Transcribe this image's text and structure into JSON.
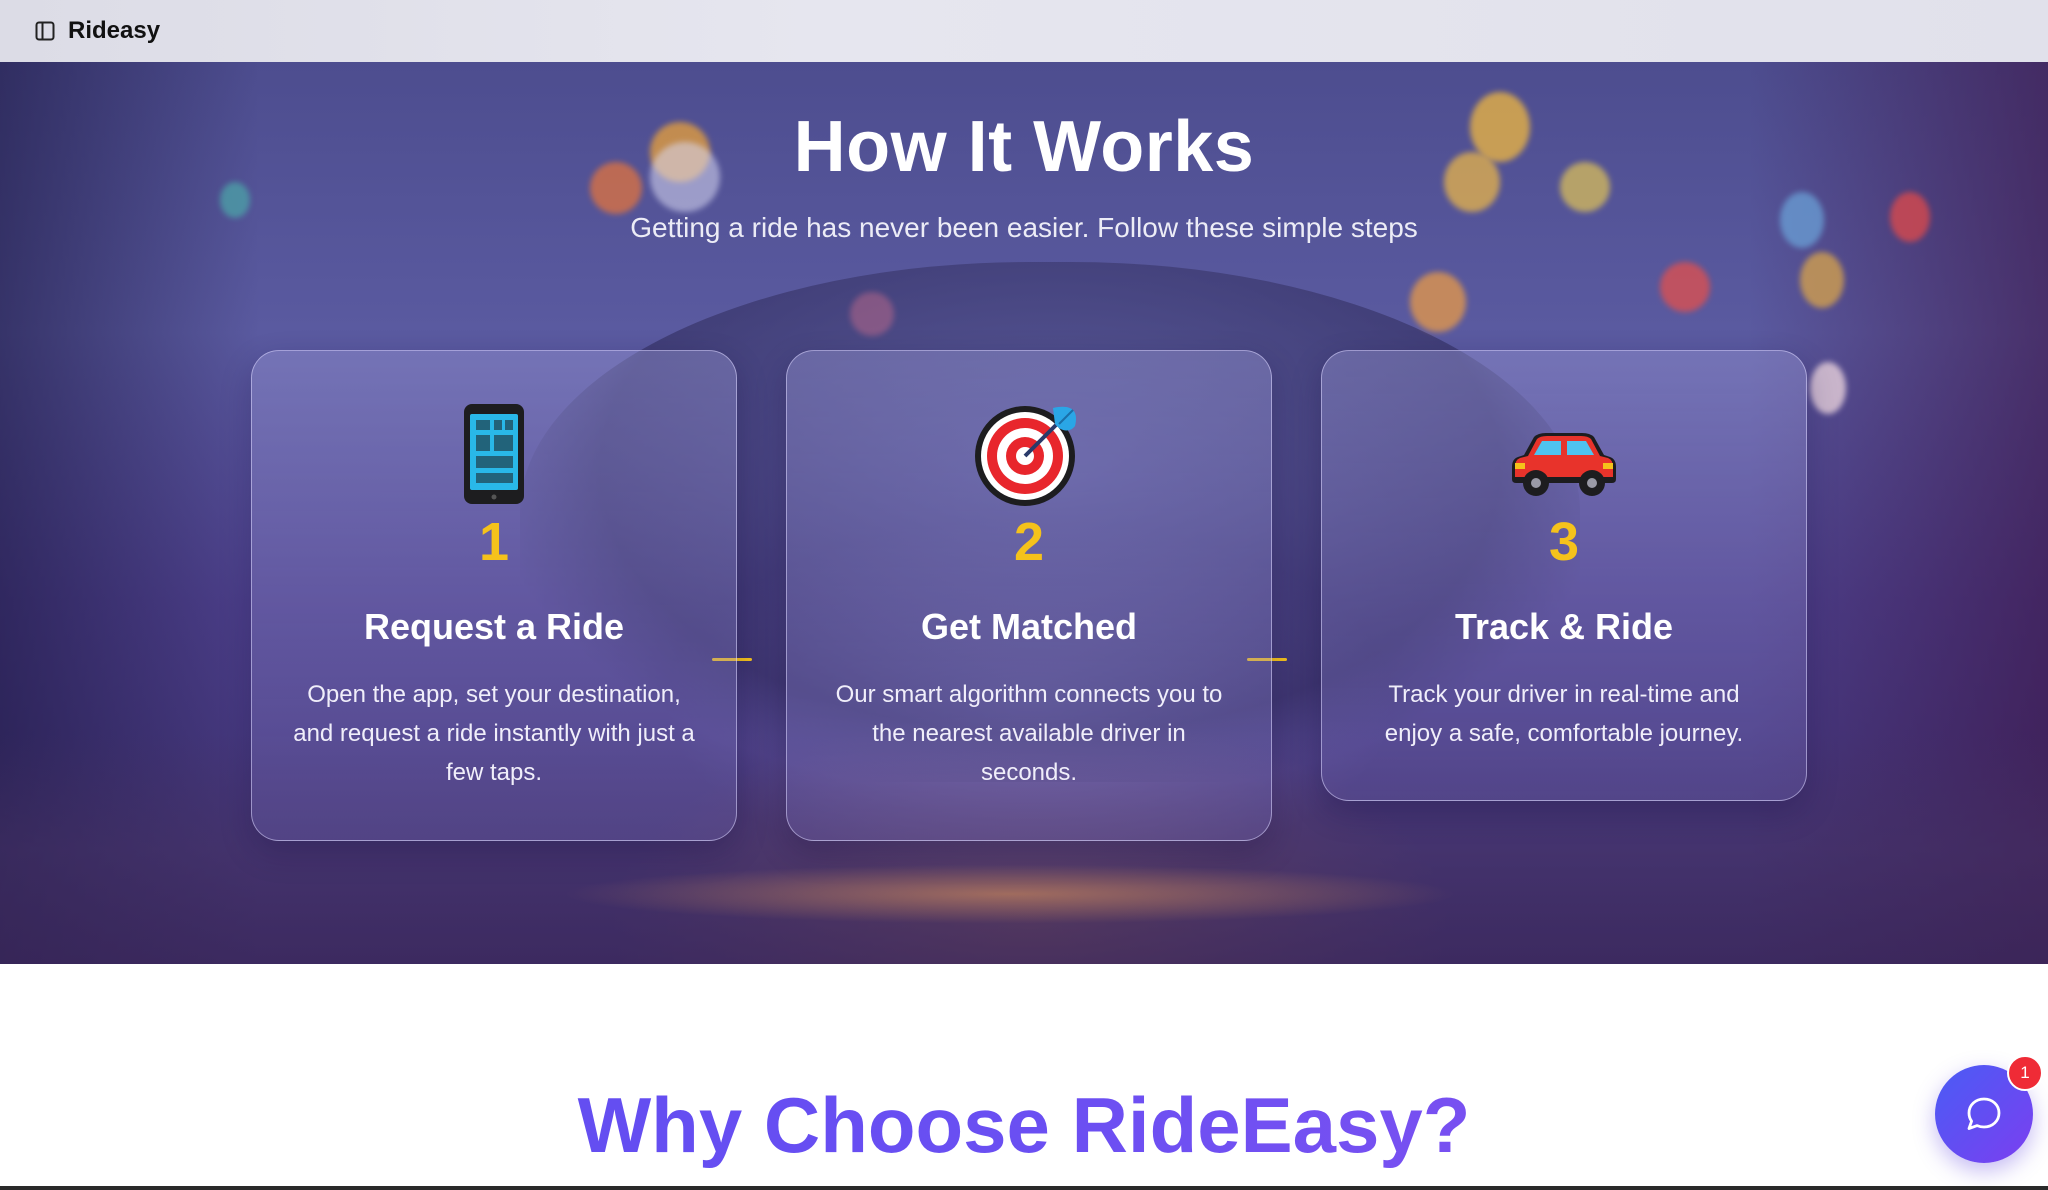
{
  "header": {
    "brand": "Rideasy",
    "sidebar_toggle_icon": "sidebar-panel-icon"
  },
  "hero": {
    "title": "How It Works",
    "subtitle": "Getting a ride has never been easier. Follow these simple steps"
  },
  "steps": [
    {
      "number": "1",
      "title": "Request a Ride",
      "text": "Open the app, set your destination, and request a ride instantly with just a few taps.",
      "icon": "mobile-phone-icon"
    },
    {
      "number": "2",
      "title": "Get Matched",
      "text": "Our smart algorithm connects you to the nearest available driver in seconds.",
      "icon": "target-icon"
    },
    {
      "number": "3",
      "title": "Track & Ride",
      "text": "Track your driver in real-time and enjoy a safe, comfortable journey.",
      "icon": "car-icon"
    }
  ],
  "why": {
    "title": "Why Choose RideEasy?"
  },
  "chat": {
    "icon": "chat-bubble-icon",
    "badge_count": "1"
  },
  "colors": {
    "accent_yellow": "#f5c21b",
    "gradient_start": "#4a5cf5",
    "gradient_end": "#7b3ff0",
    "badge_red": "#ef2b36"
  }
}
